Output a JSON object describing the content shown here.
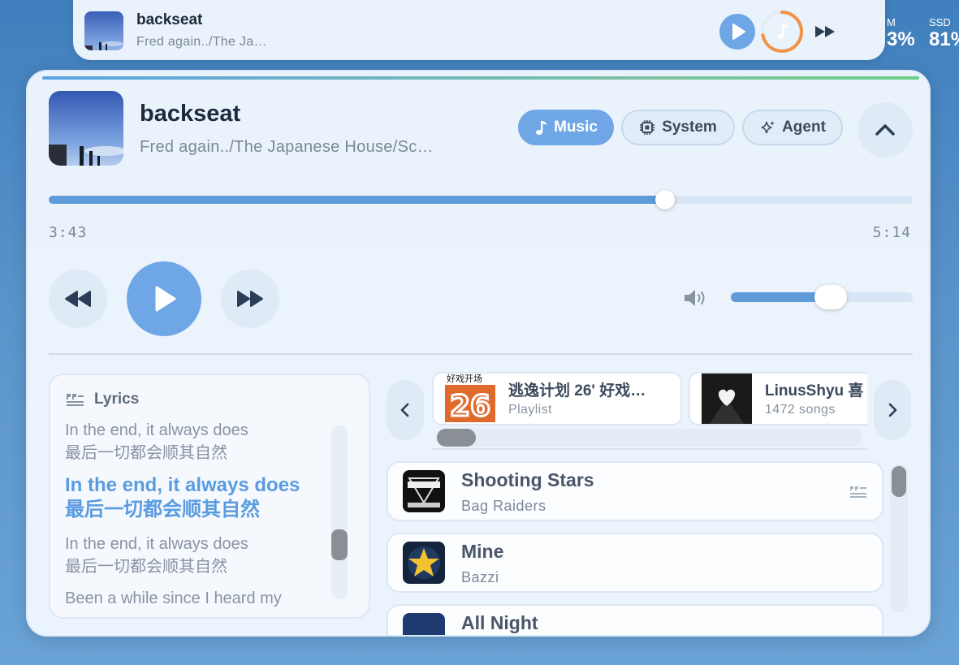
{
  "mini": {
    "title": "backseat",
    "artist": "Fred again../The Ja…",
    "progress": 0.72
  },
  "stats": [
    {
      "label": "M",
      "value": "3%"
    },
    {
      "label": "SSD",
      "value": "81%"
    }
  ],
  "player": {
    "title": "backseat",
    "artist": "Fred again../The Japanese House/Sc…",
    "elapsed": "3:43",
    "duration": "5:14",
    "progress": 0.713,
    "volume": 0.55
  },
  "tabs": [
    {
      "label": "Music",
      "icon": "music-note-icon",
      "active": true
    },
    {
      "label": "System",
      "icon": "chip-icon",
      "active": false
    },
    {
      "label": "Agent",
      "icon": "sparkle-icon",
      "active": false
    }
  ],
  "lyrics": {
    "heading": "Lyrics",
    "lines": [
      {
        "en": "In the end, it always does",
        "zh": "最后一切都会顺其自然",
        "current": false
      },
      {
        "en": "In the end, it always does",
        "zh": "最后一切都会顺其自然",
        "current": true
      },
      {
        "en": "In the end, it always does",
        "zh": "最后一切都会顺其自然",
        "current": false
      },
      {
        "en": "Been a while since I heard my",
        "zh": "",
        "current": false
      }
    ]
  },
  "playlists": [
    {
      "name": "逃逸计划 26' 好戏…",
      "sub": "Playlist",
      "art_text": "好戏开场"
    },
    {
      "name": "LinusShyu 喜",
      "sub": "1472 songs",
      "art_text": ""
    }
  ],
  "songs": [
    {
      "name": "Shooting Stars",
      "artist": "Bag Raiders",
      "has_lyrics": true
    },
    {
      "name": "Mine",
      "artist": "Bazzi",
      "has_lyrics": false
    },
    {
      "name": "All Night",
      "artist": "",
      "has_lyrics": false
    }
  ],
  "colors": {
    "accent": "#6ea6e6",
    "progress": "#5f9bd9",
    "ring": "#f0944a"
  }
}
